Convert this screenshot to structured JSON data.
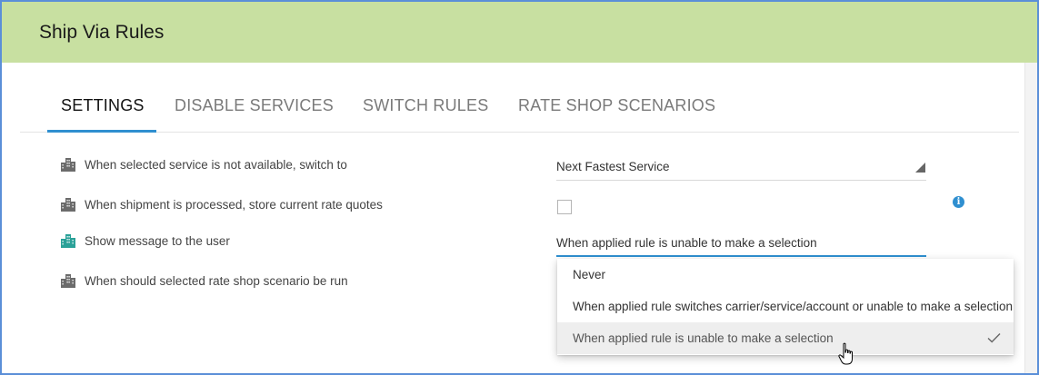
{
  "header": {
    "title": "Ship Via Rules"
  },
  "tabs": [
    {
      "label": "SETTINGS",
      "active": true
    },
    {
      "label": "DISABLE SERVICES",
      "active": false
    },
    {
      "label": "SWITCH RULES",
      "active": false
    },
    {
      "label": "RATE SHOP SCENARIOS",
      "active": false
    }
  ],
  "settings": {
    "rows": [
      {
        "label": "When selected service is not available, switch to",
        "icon": "building-icon",
        "icon_color": "#6b6b6b"
      },
      {
        "label": "When shipment is processed, store current rate quotes",
        "icon": "building-icon",
        "icon_color": "#6b6b6b"
      },
      {
        "label": "Show message to the user",
        "icon": "building-icon",
        "icon_color": "#2aa198"
      },
      {
        "label": "When should selected rate shop scenario be run",
        "icon": "building-icon",
        "icon_color": "#6b6b6b"
      }
    ],
    "switch_to_value": "Next Fastest Service",
    "store_quotes_checked": false,
    "rate_shop_run_value": "When applied rule is unable to make a selection"
  },
  "dropdown": {
    "options": [
      {
        "label": "Never",
        "selected": false
      },
      {
        "label": "When applied rule switches carrier/service/account or unable to make a selection",
        "selected": false
      },
      {
        "label": "When applied rule is unable to make a selection",
        "selected": true
      }
    ]
  },
  "colors": {
    "header_bg": "#c8e0a1",
    "accent": "#2f8fd0",
    "frame_border": "#5b8fd8"
  }
}
